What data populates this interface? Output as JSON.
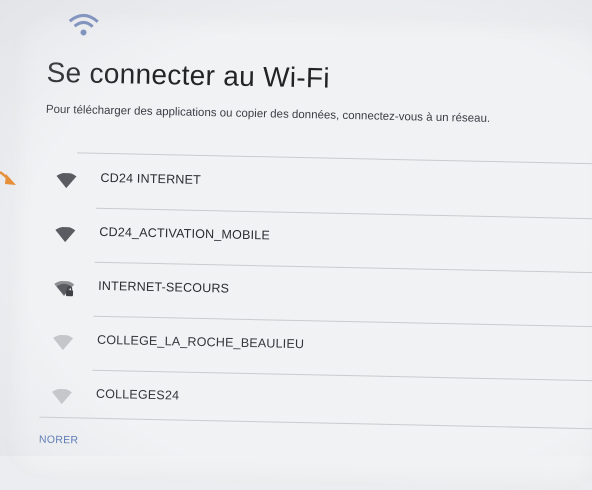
{
  "screen": {
    "title": "Se connecter au Wi-Fi",
    "subtitle": "Pour télécharger des applications ou copier des données, connectez-vous à un réseau."
  },
  "networks": [
    {
      "ssid": "CD24 INTERNET",
      "icon": "wifi-icon",
      "secured": false,
      "strength": "dark"
    },
    {
      "ssid": "CD24_ACTIVATION_MOBILE",
      "icon": "wifi-icon",
      "secured": false,
      "strength": "dark"
    },
    {
      "ssid": "INTERNET-SECOURS",
      "icon": "wifi-lock-icon",
      "secured": true,
      "strength": "medium"
    },
    {
      "ssid": "COLLEGE_LA_ROCHE_BEAULIEU",
      "icon": "wifi-icon",
      "secured": false,
      "strength": "faint"
    },
    {
      "ssid": "COLLEGES24",
      "icon": "wifi-icon",
      "secured": false,
      "strength": "faint"
    }
  ],
  "footer": {
    "skip_label": "NORER"
  },
  "colors": {
    "accent": "#4d6db0",
    "annotation_arrow": "#e88a2e",
    "wifi_dark": "#5a5c62",
    "wifi_medium": "#8d8f94",
    "wifi_faint": "#c4c6ca"
  }
}
